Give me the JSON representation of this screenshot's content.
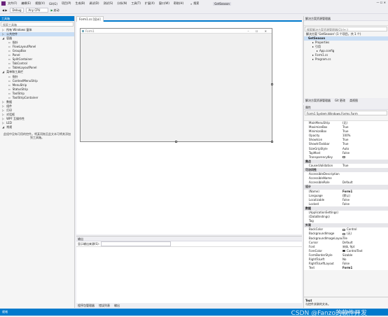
{
  "titlebar": {
    "menus": [
      "文件(F)",
      "编辑(E)",
      "视图(V)",
      "Git(G)",
      "项目(P)",
      "生成(B)",
      "调试(D)",
      "测试(S)",
      "分析(N)",
      "工具(T)",
      "扩展(X)",
      "窗口(W)",
      "帮助(H)"
    ],
    "search": "搜索",
    "solution_name": "GetSeason"
  },
  "toolbar": {
    "config": "Debug",
    "platform": "Any CPU",
    "start": "启动"
  },
  "toolbox": {
    "header": "工具箱",
    "search_placeholder": "搜索工具箱",
    "items": [
      {
        "label": "所有 Windows 窗体",
        "level": 0,
        "arrow": "▷"
      },
      {
        "label": "公共控件",
        "level": 0,
        "arrow": "▷",
        "selected": true
      },
      {
        "label": "容器",
        "level": 0,
        "arrow": "◢"
      },
      {
        "label": "指针",
        "level": 1
      },
      {
        "label": "FlowLayoutPanel",
        "level": 1
      },
      {
        "label": "GroupBox",
        "level": 1
      },
      {
        "label": "Panel",
        "level": 1
      },
      {
        "label": "SplitContainer",
        "level": 1
      },
      {
        "label": "TabControl",
        "level": 1
      },
      {
        "label": "TableLayoutPanel",
        "level": 1
      },
      {
        "label": "菜单和工具栏",
        "level": 0,
        "arrow": "◢"
      },
      {
        "label": "指针",
        "level": 1
      },
      {
        "label": "ContextMenuStrip",
        "level": 1
      },
      {
        "label": "MenuStrip",
        "level": 1
      },
      {
        "label": "StatusStrip",
        "level": 1
      },
      {
        "label": "ToolStrip",
        "level": 1
      },
      {
        "label": "ToolStripContainer",
        "level": 1
      },
      {
        "label": "数据",
        "level": 0,
        "arrow": "▷"
      },
      {
        "label": "组件",
        "level": 0,
        "arrow": "▷"
      },
      {
        "label": "打印",
        "level": 0,
        "arrow": "▷"
      },
      {
        "label": "对话框",
        "level": 0,
        "arrow": "▷"
      },
      {
        "label": "WPF 互操作性",
        "level": 0,
        "arrow": "▷"
      },
      {
        "label": "LED",
        "level": 0,
        "arrow": "▷"
      },
      {
        "label": "常规",
        "level": 0,
        "arrow": "◢"
      }
    ],
    "empty_hint": "此组中没有可用的控件。将某项拖至此文本可将其添加到工具箱。"
  },
  "designer": {
    "tab": "Form1.cs [设计]",
    "form_caption": "Form1"
  },
  "output": {
    "header": "输出",
    "source_label": "显示输出来源(S):",
    "tabs": [
      "程序包管理器",
      "错误列表",
      "输出"
    ]
  },
  "explorer": {
    "header": "解决方案资源管理器",
    "search_placeholder": "搜索解决方案资源管理器(Ctrl+;)",
    "solution": "解决方案 'GetSeason' (1 个项目，共 1 个)",
    "project": "GetSeason",
    "nodes": [
      "Properties",
      "引用",
      "App.config",
      "Form1.cs",
      "Program.cs"
    ],
    "tabs": [
      "解决方案资源管理器",
      "Git 更改",
      "类视图"
    ]
  },
  "props": {
    "header": "属性",
    "object": "Form1 System.Windows.Forms.Form",
    "rows": [
      {
        "k": "MainMenuStrip",
        "v": "(无)"
      },
      {
        "k": "MaximizeBox",
        "v": "True"
      },
      {
        "k": "MinimizeBox",
        "v": "True"
      },
      {
        "k": "Opacity",
        "v": "100%"
      },
      {
        "k": "ShowIcon",
        "v": "True"
      },
      {
        "k": "ShowInTaskbar",
        "v": "True"
      },
      {
        "k": "SizeGripStyle",
        "v": "Auto"
      },
      {
        "k": "TopMost",
        "v": "False"
      },
      {
        "k": "TransparencyKey",
        "v": "",
        "swatch": "#ffffff"
      },
      {
        "cat": "焦点"
      },
      {
        "k": "CausesValidation",
        "v": "True"
      },
      {
        "cat": "可访问性"
      },
      {
        "k": "AccessibleDescription",
        "v": ""
      },
      {
        "k": "AccessibleName",
        "v": ""
      },
      {
        "k": "AccessibleRole",
        "v": "Default"
      },
      {
        "cat": "设计"
      },
      {
        "k": "(Name)",
        "v": "Form1",
        "bold": true
      },
      {
        "k": "Language",
        "v": "(默认)"
      },
      {
        "k": "Localizable",
        "v": "False"
      },
      {
        "k": "Locked",
        "v": "False"
      },
      {
        "cat": "数据"
      },
      {
        "k": "(ApplicationSettings)",
        "v": ""
      },
      {
        "k": "(DataBindings)",
        "v": ""
      },
      {
        "k": "Tag",
        "v": ""
      },
      {
        "cat": "外观"
      },
      {
        "k": "BackColor",
        "v": "Control",
        "swatch": "#f0f0f0"
      },
      {
        "k": "BackgroundImage",
        "v": "(无)",
        "swatch": "#ffffff"
      },
      {
        "k": "BackgroundImageLayou",
        "v": "Tile"
      },
      {
        "k": "Cursor",
        "v": "Default"
      },
      {
        "k": "Font",
        "v": "宋体, 9pt"
      },
      {
        "k": "ForeColor",
        "v": "ControlText",
        "swatch": "#000000"
      },
      {
        "k": "FormBorderStyle",
        "v": "Sizable"
      },
      {
        "k": "RightToLeft",
        "v": "No"
      },
      {
        "k": "RightToLeftLayout",
        "v": "False"
      },
      {
        "k": "Text",
        "v": "Form1",
        "bold": true
      }
    ],
    "desc_title": "Text",
    "desc_text": "与控件关联的文本。"
  },
  "status": {
    "left": "就绪",
    "right": "添加到源代码管理",
    "watermark": "CSDN @Fanzo的软件开发"
  }
}
